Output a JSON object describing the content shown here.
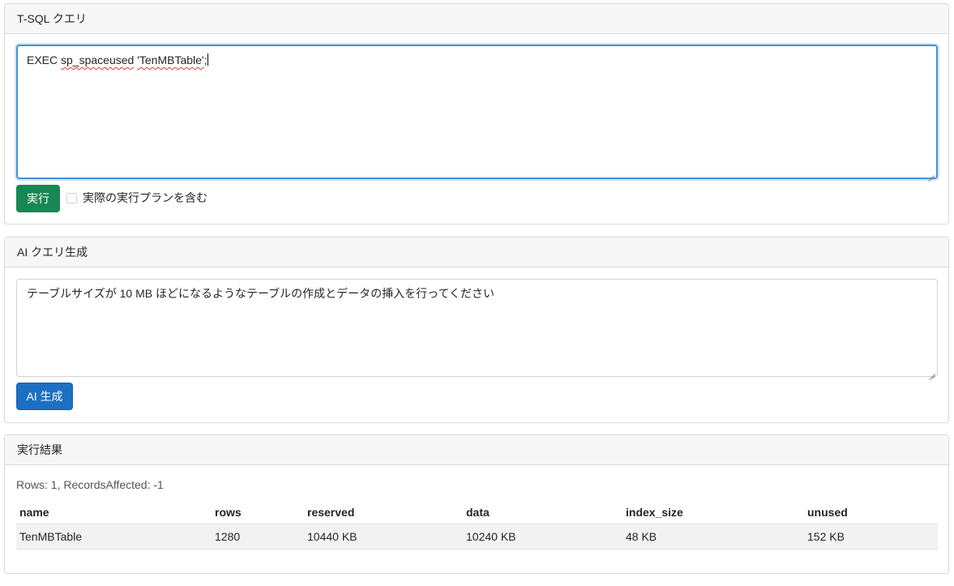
{
  "tsql_card": {
    "title": "T-SQL クエリ",
    "query_prefix": "EXEC ",
    "query_word1": "sp_spaceused",
    "query_space": " ",
    "query_word2": "'TenMBTable'",
    "query_suffix": ";",
    "run_button_label": "実行",
    "include_plan_label": "実際の実行プランを含む",
    "include_plan_checked": false
  },
  "ai_card": {
    "title": "AI クエリ生成",
    "prompt_text": "テーブルサイズが 10 MB ほどになるようなテーブルの作成とデータの挿入を行ってください",
    "generate_button_label": "AI 生成"
  },
  "result_card": {
    "title": "実行結果",
    "summary": "Rows: 1, RecordsAffected: -1",
    "columns": [
      "name",
      "rows",
      "reserved",
      "data",
      "index_size",
      "unused"
    ],
    "rows": [
      [
        "TenMBTable",
        "1280",
        "10440 KB",
        "10240 KB",
        "48 KB",
        "152 KB"
      ]
    ]
  },
  "colors": {
    "run_button": "#198754",
    "generate_button": "#1d6fc2",
    "focus_border": "#4a90d9"
  }
}
